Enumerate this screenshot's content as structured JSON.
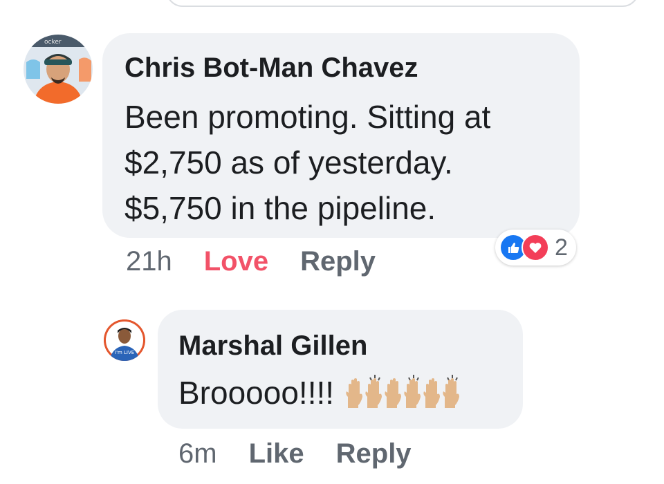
{
  "comments": [
    {
      "author": "Chris Bot-Man Chavez",
      "text": "Been promoting. Sitting at\n$2,750 as of yesterday.\n$5,750 in the pipeline.",
      "time": "21h",
      "reaction_action": "Love",
      "reply_label": "Reply",
      "reactions": {
        "icons": [
          "thumbs-up-icon",
          "heart-icon"
        ],
        "count": "2"
      },
      "avatar_caption": "ocker"
    },
    {
      "author": "Marshal Gillen",
      "text": "Brooooo!!!!",
      "emoji": [
        "raised-hands-emoji",
        "raised-hands-emoji",
        "raised-hands-emoji",
        "raised-hands-emoji",
        "raised-hands-emoji",
        "raised-hands-emoji"
      ],
      "time": "6m",
      "reaction_action": "Like",
      "reply_label": "Reply",
      "avatar_caption": "I'm LIVE"
    }
  ],
  "colors": {
    "bubble": "#f0f2f5",
    "meta_text": "#606770",
    "love_action": "#f25268",
    "like_reaction": "#1877f2",
    "love_reaction": "#f33e58"
  }
}
